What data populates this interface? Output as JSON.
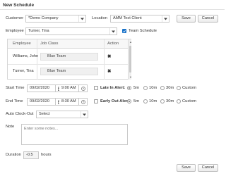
{
  "window": {
    "title": "New Schedule"
  },
  "customer": {
    "label": "Customer",
    "value": "*Demo Company"
  },
  "location": {
    "label": "Location",
    "value": "AMM Test Client"
  },
  "employee": {
    "label": "Employee",
    "value": "Turner, Tina"
  },
  "team_schedule": {
    "label": "Team Schedule",
    "checked": true
  },
  "buttons": {
    "save": "Save",
    "cancel": "Cancel"
  },
  "employee_table": {
    "columns": [
      "Employee",
      "Job Class",
      "Action"
    ],
    "rows": [
      {
        "employee": "Williams, John",
        "job_class": "Blue Team",
        "action": "remove-icon"
      },
      {
        "employee": "Turner, Tina",
        "job_class": "Blue Team",
        "action": "remove-icon"
      }
    ]
  },
  "start": {
    "label": "Start Time",
    "date": "09/02/2020",
    "time": "9:00 AM",
    "alert_label": "Late In Alert:",
    "alert_checked": false
  },
  "end": {
    "label": "End Time",
    "date": "09/02/2020",
    "time": "8:30 AM",
    "alert_label": "Early Out Alert:",
    "alert_checked": false
  },
  "alert_options": [
    "5m",
    "10m",
    "30m",
    "Custom"
  ],
  "alert_selected": "5m",
  "auto_clock_out": {
    "label": "Auto Clock-Out",
    "value": "Select"
  },
  "note": {
    "label": "Note",
    "placeholder": "Enter some notes..."
  },
  "duration": {
    "label": "Duration",
    "value": "-0.5",
    "unit": "hours"
  },
  "colors": {
    "accent": "#1a73c9",
    "border": "#c8c8c8"
  }
}
